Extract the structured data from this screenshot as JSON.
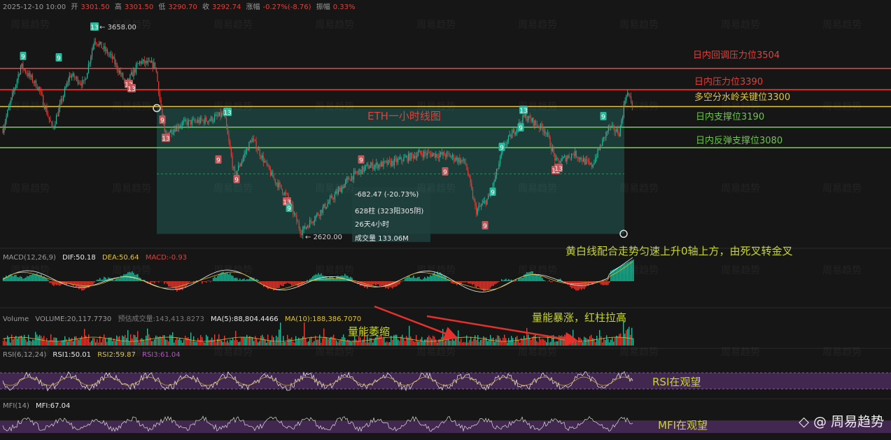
{
  "header": {
    "date": "2025-12-10 10:00",
    "open_label": "开",
    "open": "3301.50",
    "high_label": "高",
    "high": "3301.50",
    "low_label": "低",
    "low": "3290.70",
    "close_label": "收",
    "close": "3292.74",
    "change_label": "涨幅",
    "change": "-0.27%(-8.76)",
    "amp_label": "振幅",
    "amp": "0.33%"
  },
  "price_labels": {
    "high_point": "3658.00",
    "low_point": "2620.00",
    "chart_title": "ETH一小时线图"
  },
  "measure": {
    "change": "-682.47 (-20.73%)",
    "bars": "628柱 (323阳305阴)",
    "duration": "26天4小时",
    "volume": "成交量 133.06M"
  },
  "macd": {
    "name": "MACD(12,26,9)",
    "dif": "DIF:50.18",
    "dea": "DEA:50.64",
    "macd": "MACD:-0.93"
  },
  "volume": {
    "name": "Volume",
    "vol": "VOLUME:20,117.7730",
    "est": "预估成交量:143,413.8273",
    "ma5": "MA(5):88,804.4466",
    "ma10": "MA(10):188,386.7070"
  },
  "rsi": {
    "name": "RSI(6,12,24)",
    "r1": "RSI1:50.01",
    "r2": "RSI2:59.87",
    "r3": "RSI3:61.04"
  },
  "mfi": {
    "name": "MFI(14)",
    "v": "MFI:67.04"
  },
  "annotations": {
    "macd_note": "黄白线配合走势匀速上升0轴上方，由死叉转金叉",
    "vol_shrink": "量能萎缩",
    "vol_surge": "量能暴涨，红柱拉高",
    "rsi_note": "RSI在观望",
    "mfi_note": "MFI在观望"
  },
  "brand": "@ 周易趋势",
  "watermark": "周易趋势",
  "colors": {
    "bg": "#161616",
    "up": "#2bb89a",
    "down": "#e0413a",
    "red_line": "#e0413a",
    "yellow_line": "#d9b52a",
    "green_line": "#3fae3f",
    "box": "#1d4a46",
    "note_green": "#c8d62e",
    "purple_band": "#4a2a5c"
  },
  "chart_data": {
    "type": "candlestick",
    "interval": "1h",
    "title": "ETH一小时线图",
    "levels": [
      {
        "name": "日内回调压力位3504",
        "value": 3504,
        "color": "#e0413a"
      },
      {
        "name": "日内压力位3390",
        "value": 3390,
        "color": "#e0413a"
      },
      {
        "name": "多空分水岭关键位3300",
        "value": 3300,
        "color": "#e3c53a"
      },
      {
        "name": "日内支撑位3190",
        "value": 3190,
        "color": "#6cc64a"
      },
      {
        "name": "日内反弹支撑位3080",
        "value": 3080,
        "color": "#6cc64a"
      }
    ],
    "ylim": [
      2580,
      3720
    ],
    "high": 3658.0,
    "low": 2620.0,
    "last": 3292.74,
    "td_markers": [
      {
        "label": "9",
        "up": true,
        "v": 3560
      },
      {
        "label": "9",
        "up": true,
        "v": 3560
      },
      {
        "label": "13",
        "up": true,
        "v": 3665
      },
      {
        "label": "13",
        "up": false,
        "v": 3395
      },
      {
        "label": "13",
        "up": false,
        "v": 3375
      },
      {
        "label": "9",
        "up": false,
        "v": 3230
      },
      {
        "label": "13",
        "up": false,
        "v": 3135
      },
      {
        "label": "13",
        "up": true,
        "v": 3255
      },
      {
        "label": "9",
        "up": false,
        "v": 2980
      },
      {
        "label": "9",
        "up": false,
        "v": 2945
      },
      {
        "label": "9",
        "up": false,
        "v": 2790
      },
      {
        "label": "13",
        "up": false,
        "v": 2775
      },
      {
        "label": "9",
        "up": true,
        "v": 3015
      },
      {
        "label": "9",
        "up": false,
        "v": 2965
      },
      {
        "label": "9",
        "up": false,
        "v": 2760
      },
      {
        "label": "9",
        "up": false,
        "v": 2700
      },
      {
        "label": "9",
        "up": true,
        "v": 2840
      },
      {
        "label": "9",
        "up": true,
        "v": 3075
      },
      {
        "label": "9",
        "up": true,
        "v": 3170
      },
      {
        "label": "13",
        "up": true,
        "v": 3255
      },
      {
        "label": "13",
        "up": false,
        "v": 2975
      },
      {
        "label": "13",
        "up": false,
        "v": 2985
      },
      {
        "label": "9",
        "up": true,
        "v": 3220
      }
    ]
  }
}
